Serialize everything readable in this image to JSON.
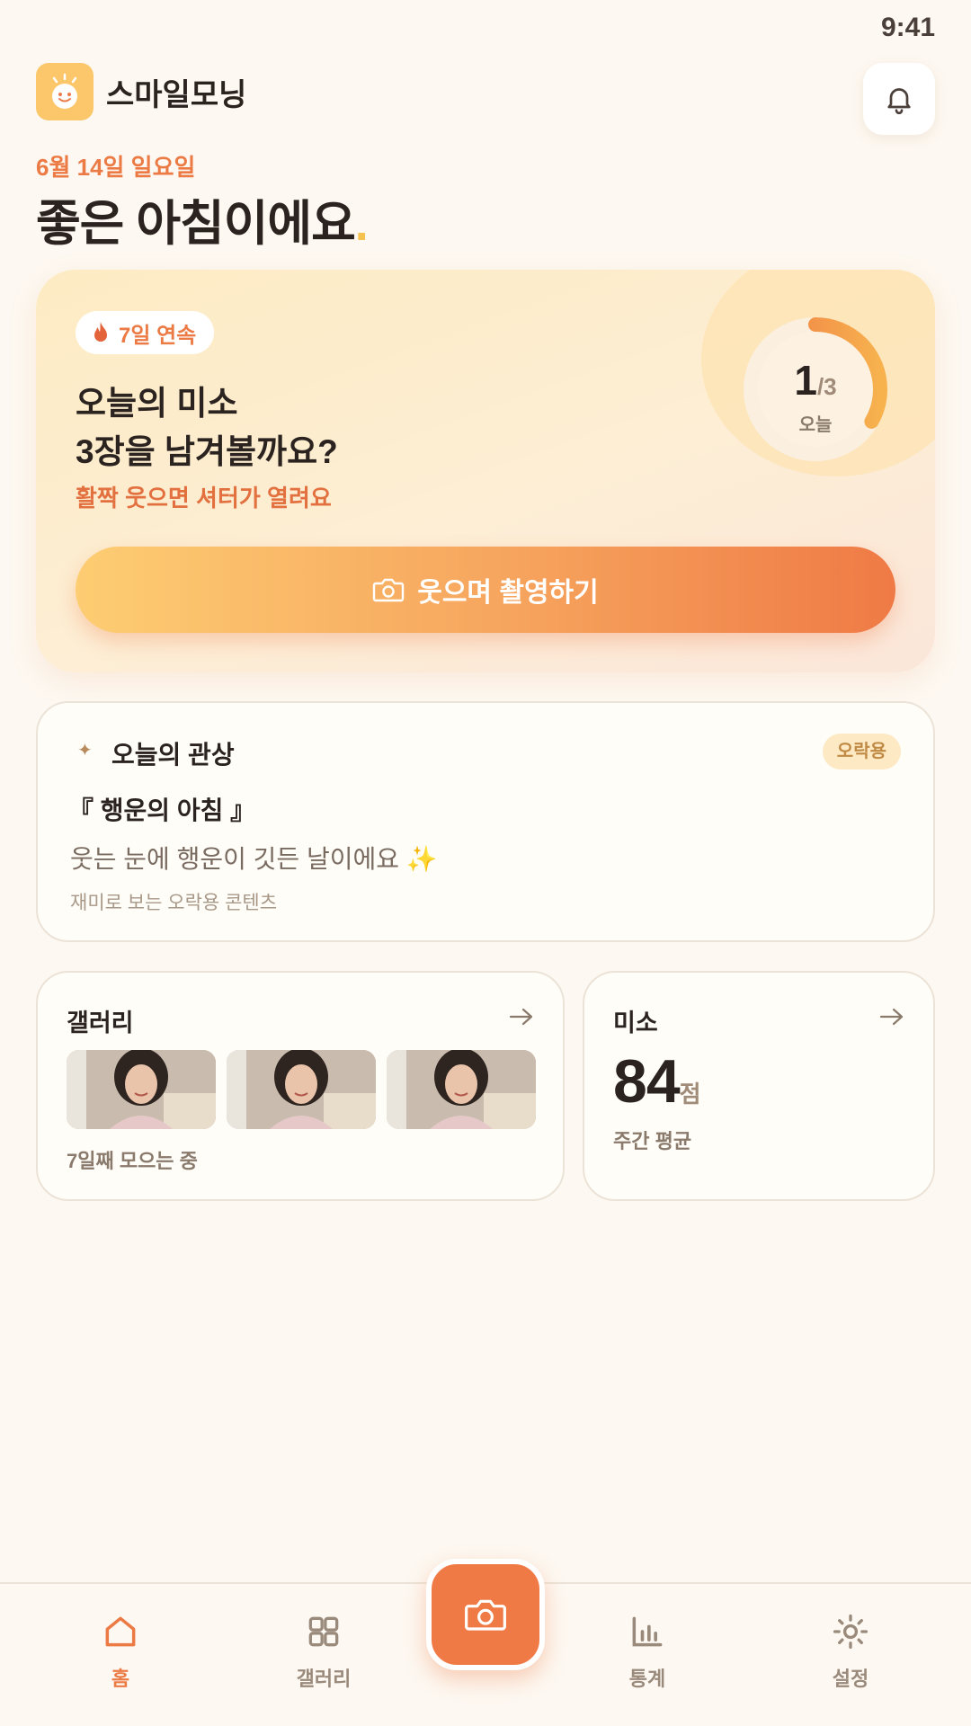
{
  "status": {
    "time": "9:41"
  },
  "header": {
    "app_name": "스마일모닝"
  },
  "date_line": "6월 14일 일요일",
  "greeting": {
    "text": "좋은 아침이에요",
    "dot": "."
  },
  "hero": {
    "streak": "7일 연속",
    "title_line1": "오늘의 미소",
    "title_line2": "3장을 남겨볼까요?",
    "subtitle": "활짝 웃으면 셔터가 열려요",
    "progress": {
      "current": "1",
      "total": "/3",
      "label": "오늘",
      "fraction": 0.333
    },
    "cta_label": "웃으며 촬영하기"
  },
  "fortune": {
    "title": "오늘의 관상",
    "tag": "오락용",
    "heading": "『 행운의 아침 』",
    "text": "웃는 눈에 행운이 깃든 날이에요 ✨",
    "note": "재미로 보는 오락용 콘텐츠"
  },
  "gallery": {
    "title": "갤러리",
    "note": "7일째 모으는 중"
  },
  "stats": {
    "title": "미소",
    "score": "84",
    "unit": "점",
    "label": "주간 평균"
  },
  "tabbar": {
    "home": "홈",
    "gallery": "갤러리",
    "stats": "통계",
    "settings": "설정"
  },
  "colors": {
    "accent": "#ef7a45",
    "accent_light": "#fdcd72",
    "background": "#fdf8f1"
  }
}
